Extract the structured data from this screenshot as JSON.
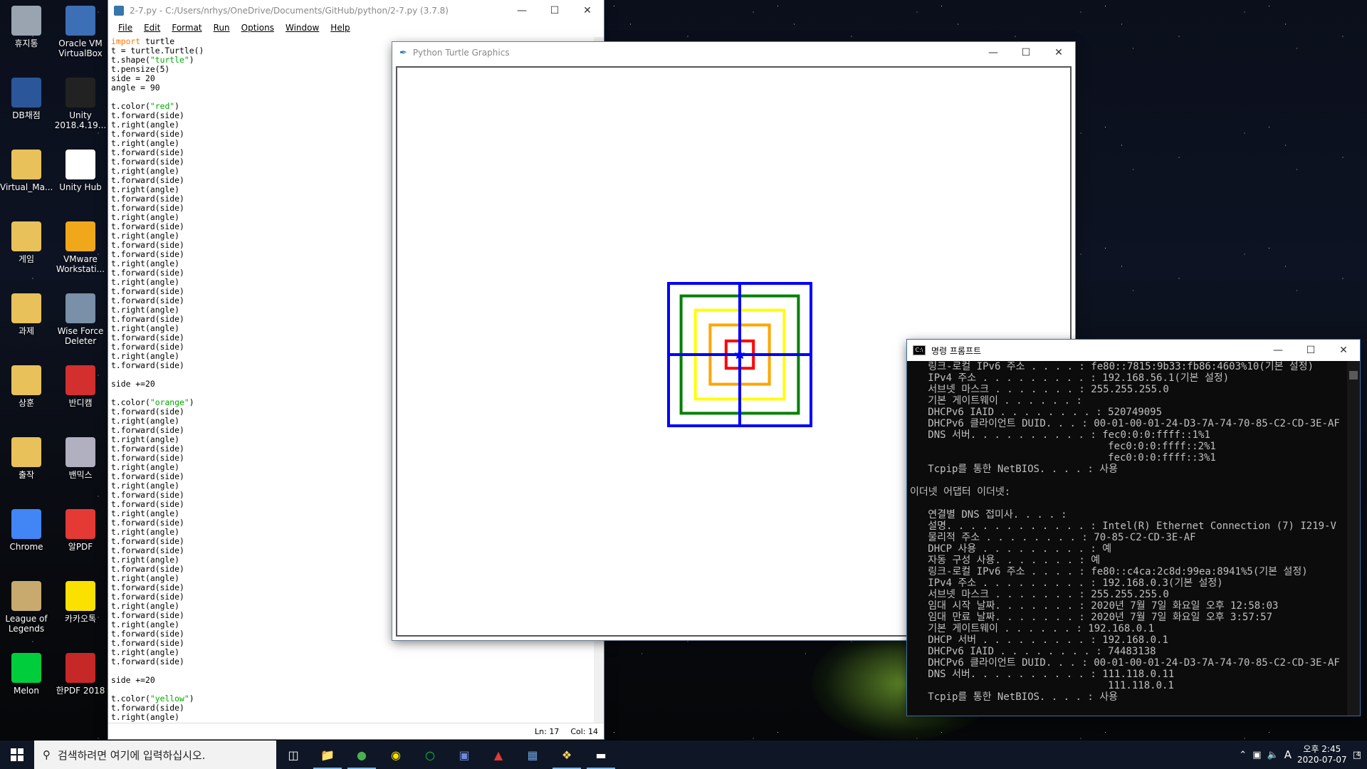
{
  "desktop": {
    "icons": [
      {
        "label": "휴지통",
        "icon": "recycle-bin-icon",
        "color": "#9aa4b0"
      },
      {
        "label": "Oracle VM VirtualBox",
        "icon": "virtualbox-icon",
        "color": "#3d6fb6"
      },
      {
        "label": "DB채점",
        "icon": "word-doc-icon",
        "color": "#2b579a"
      },
      {
        "label": "Unity 2018.4.19...",
        "icon": "unity-icon",
        "color": "#222222"
      },
      {
        "label": "Virtual_Ma...",
        "icon": "folder-icon",
        "color": "#e8c15a"
      },
      {
        "label": "Unity Hub",
        "icon": "unity-hub-icon",
        "color": "#ffffff"
      },
      {
        "label": "게임",
        "icon": "folder-icon",
        "color": "#e8c15a"
      },
      {
        "label": "VMware Workstati...",
        "icon": "vmware-icon",
        "color": "#f0a81a"
      },
      {
        "label": "과제",
        "icon": "folder-icon",
        "color": "#e8c15a"
      },
      {
        "label": "Wise Force Deleter",
        "icon": "wise-force-deleter-icon",
        "color": "#7a8fa8"
      },
      {
        "label": "상훈",
        "icon": "folder-icon",
        "color": "#e8c15a"
      },
      {
        "label": "반디캠",
        "icon": "bandicam-icon",
        "color": "#d32f2f"
      },
      {
        "label": "출작",
        "icon": "folder-icon",
        "color": "#e8c15a"
      },
      {
        "label": "밴믹스",
        "icon": "bandimix-icon",
        "color": "#b0b0c0"
      },
      {
        "label": "Chrome",
        "icon": "chrome-icon",
        "color": "#4285f4"
      },
      {
        "label": "알PDF",
        "icon": "alpdf-icon",
        "color": "#e53935"
      },
      {
        "label": "League of Legends",
        "icon": "league-of-legends-icon",
        "color": "#c8aa6e"
      },
      {
        "label": "카카오톡",
        "icon": "kakaotalk-icon",
        "color": "#fae100"
      },
      {
        "label": "Melon",
        "icon": "melon-icon",
        "color": "#00cd3c"
      },
      {
        "label": "한PDF 2018",
        "icon": "hanpdf-icon",
        "color": "#c62828"
      }
    ]
  },
  "idle": {
    "title": "2-7.py - C:/Users/nrhys/OneDrive/Documents/GitHub/python/2-7.py (3.7.8)",
    "menu": [
      "File",
      "Edit",
      "Format",
      "Run",
      "Options",
      "Window",
      "Help"
    ],
    "status": {
      "ln": "Ln: 17",
      "col": "Col: 14"
    },
    "header_lines": [
      "t = turtle.Turtle()",
      "t.pensize(5)",
      "side = 20",
      "angle = 90"
    ],
    "import_kw": "import",
    "import_mod": " turtle",
    "shape_pre": "t.shape(",
    "shape_arg": "\"turtle\"",
    "shape_post": ")",
    "color_pre": "t.color(",
    "color_post": ")",
    "colors": [
      "\"red\"",
      "\"orange\"",
      "\"yellow\""
    ],
    "fwd": "t.forward(side)",
    "rgt": "t.right(angle)",
    "side_inc": "side +=20"
  },
  "turtle": {
    "title": "Python Turtle Graphics",
    "colors": {
      "red": "#ff0000",
      "orange": "#ffa500",
      "yellow": "#ffff00",
      "green": "#008000",
      "blue": "#0000ff"
    }
  },
  "cmd": {
    "title": "명령 프롬프트",
    "lines": [
      "   링크-로컬 IPv6 주소 . . . . : fe80::7815:9b33:fb86:4603%10(기본 설정)",
      "   IPv4 주소 . . . . . . . . . : 192.168.56.1(기본 설정)",
      "   서브넷 마스크 . . . . . . . : 255.255.255.0",
      "   기본 게이트웨이 . . . . . . :",
      "   DHCPv6 IAID . . . . . . . . : 520749095",
      "   DHCPv6 클라이언트 DUID. . . : 00-01-00-01-24-D3-7A-74-70-85-C2-CD-3E-AF",
      "   DNS 서버. . . . . . . . . . : fec0:0:0:ffff::1%1",
      "                                 fec0:0:0:ffff::2%1",
      "                                 fec0:0:0:ffff::3%1",
      "   Tcpip를 통한 NetBIOS. . . . : 사용",
      "",
      "이더넷 어댑터 이더넷:",
      "",
      "   연결별 DNS 접미사. . . . :",
      "   설명. . . . . . . . . . . . : Intel(R) Ethernet Connection (7) I219-V",
      "   물리적 주소 . . . . . . . . : 70-85-C2-CD-3E-AF",
      "   DHCP 사용 . . . . . . . . . : 예",
      "   자동 구성 사용. . . . . . . : 예",
      "   링크-로컬 IPv6 주소 . . . . : fe80::c4ca:2c8d:99ea:8941%5(기본 설정)",
      "   IPv4 주소 . . . . . . . . . : 192.168.0.3(기본 설정)",
      "   서브넷 마스크 . . . . . . . : 255.255.255.0",
      "   임대 시작 날짜. . . . . . . : 2020년 7월 7일 화요일 오후 12:58:03",
      "   임대 만료 날짜. . . . . . . : 2020년 7월 7일 화요일 오후 3:57:57",
      "   기본 게이트웨이 . . . . . . : 192.168.0.1",
      "   DHCP 서버 . . . . . . . . . : 192.168.0.1",
      "   DHCPv6 IAID . . . . . . . . : 74483138",
      "   DHCPv6 클라이언트 DUID. . . : 00-01-00-01-24-D3-7A-74-70-85-C2-CD-3E-AF",
      "   DNS 서버. . . . . . . . . . : 111.118.0.11",
      "                                 111.118.0.1",
      "   Tcpip를 통한 NetBIOS. . . . : 사용"
    ]
  },
  "taskbar": {
    "search_placeholder": "검색하려면 여기에 입력하십시오.",
    "apps": [
      "task-view-icon",
      "file-explorer-icon",
      "chrome-icon",
      "kakaotalk-icon",
      "melon-icon",
      "discord-icon",
      "acrobat-icon",
      "virtualbox-icon",
      "python-icon",
      "cmd-icon"
    ],
    "ime": "A",
    "time": "오후 2:45",
    "date": "2020-07-07",
    "notifications": "4"
  }
}
